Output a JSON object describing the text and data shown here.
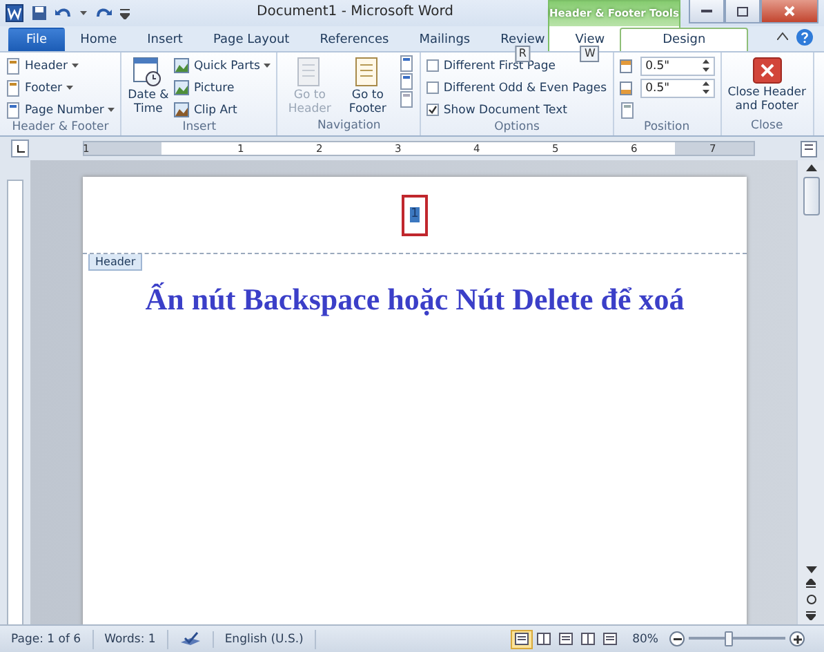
{
  "window": {
    "title": "Document1 - Microsoft Word",
    "context_title": "Header & Footer Tools"
  },
  "tabs": [
    {
      "label": "File",
      "kind": "file",
      "selected": false
    },
    {
      "label": "Home",
      "kind": "tab",
      "selected": false
    },
    {
      "label": "Insert",
      "kind": "tab",
      "selected": false
    },
    {
      "label": "Page Layout",
      "kind": "tab",
      "selected": false
    },
    {
      "label": "References",
      "kind": "tab",
      "selected": false
    },
    {
      "label": "Mailings",
      "kind": "tab",
      "selected": false
    },
    {
      "label": "Review",
      "kind": "tab",
      "selected": false,
      "key_tip": "R"
    },
    {
      "label": "View",
      "kind": "tab",
      "selected": false,
      "key_tip": "W"
    },
    {
      "label": "Design",
      "kind": "context",
      "selected": true
    }
  ],
  "ribbon": [
    {
      "label": "Header & Footer",
      "items": [
        {
          "kind": "small",
          "label": "Header",
          "dropdown": true
        },
        {
          "kind": "small",
          "label": "Footer",
          "dropdown": true
        },
        {
          "kind": "small",
          "label": "Page Number",
          "dropdown": true
        }
      ]
    },
    {
      "label": "Insert",
      "items": [
        {
          "kind": "large",
          "label": "Date & Time"
        },
        {
          "kind": "small",
          "label": "Quick Parts",
          "dropdown": true
        },
        {
          "kind": "small",
          "label": "Picture",
          "dropdown": false
        },
        {
          "kind": "small",
          "label": "Clip Art",
          "dropdown": false
        }
      ]
    },
    {
      "label": "Navigation",
      "items": [
        {
          "kind": "large",
          "label": "Go to Header",
          "disabled": true
        },
        {
          "kind": "large",
          "label": "Go to Footer",
          "disabled": false
        },
        {
          "kind": "icons"
        }
      ]
    },
    {
      "label": "Options",
      "items": [
        {
          "kind": "checkbox",
          "label": "Different First Page",
          "checked": false
        },
        {
          "kind": "checkbox",
          "label": "Different Odd & Even Pages",
          "checked": false
        },
        {
          "kind": "checkbox",
          "label": "Show Document Text",
          "checked": true
        }
      ]
    },
    {
      "label": "Position",
      "items": [
        {
          "kind": "spin",
          "value": "0.5\""
        },
        {
          "kind": "spin",
          "value": "0.5\""
        },
        {
          "kind": "tab-icon"
        }
      ]
    },
    {
      "label": "Close",
      "items": [
        {
          "kind": "close",
          "label": "Close Header and Footer"
        }
      ]
    }
  ],
  "ruler": {
    "labels": [
      "1",
      "1",
      "2",
      "3",
      "4",
      "5",
      "6",
      "7"
    ]
  },
  "document": {
    "header_tag": "Header",
    "page_field": "1",
    "heading": "Ấn nút Backspace hoặc Nút Delete để xoá"
  },
  "status_bar": {
    "items": [
      "Page: 1 of 6",
      "Words: 1",
      "English (U.S.)"
    ],
    "views": [
      {
        "selected": true
      },
      {
        "selected": false
      },
      {
        "selected": false
      },
      {
        "selected": false
      },
      {
        "selected": false
      }
    ],
    "zoom": "80%",
    "zoom_level": {
      "level": 0.42
    }
  }
}
